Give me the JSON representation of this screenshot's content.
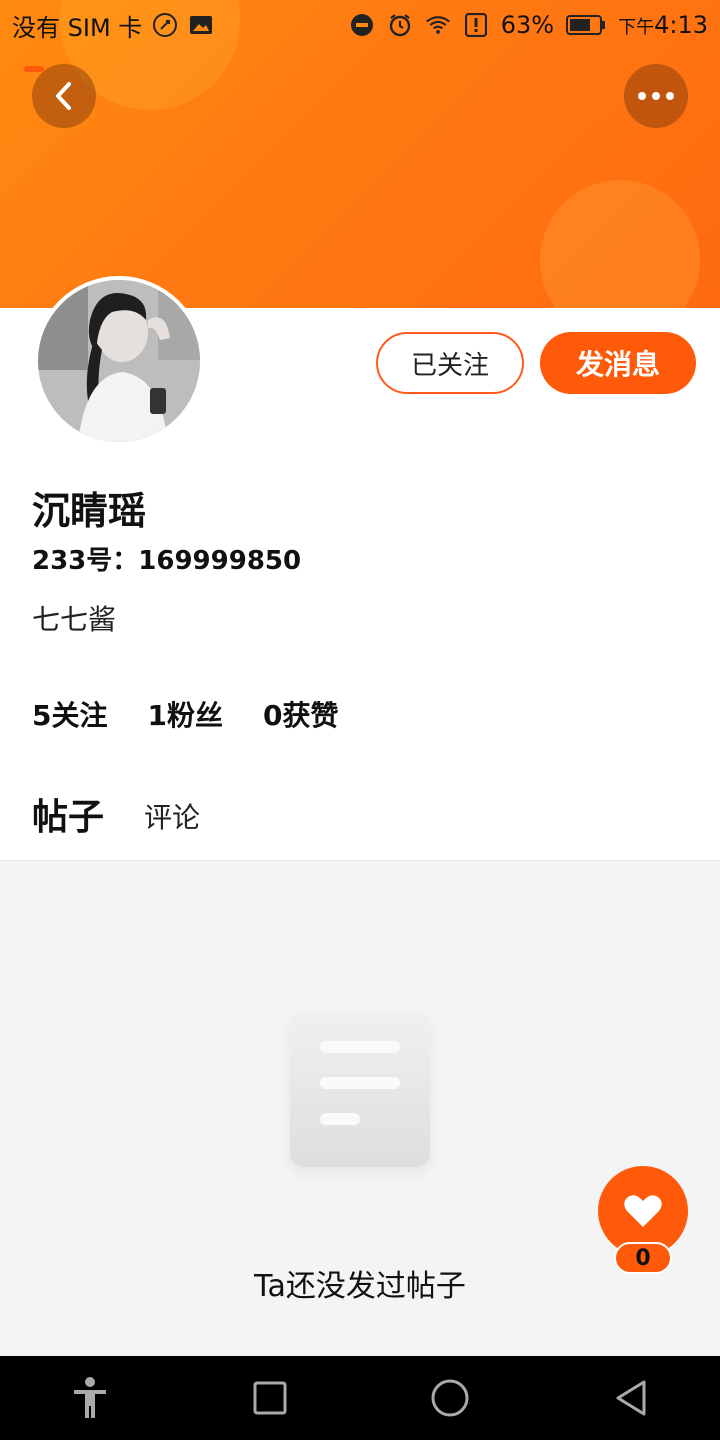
{
  "status_bar": {
    "carrier": "没有 SIM 卡",
    "battery": "63%",
    "time_prefix": "下午",
    "time": "4:13"
  },
  "profile": {
    "name": "沉睛瑶",
    "uid": "233号：169999850",
    "signature": "七七酱",
    "follow_button": "已关注",
    "message_button": "发消息"
  },
  "stats": {
    "following": "5关注",
    "followers": "1粉丝",
    "likes": "0获赞"
  },
  "tabs": {
    "posts": "帖子",
    "comments": "评论"
  },
  "empty_state": {
    "text": "Ta还没发过帖子"
  },
  "like_fab": {
    "count": "0"
  },
  "colors": {
    "accent": "#ff5a0a",
    "banner": "#ff7a12"
  }
}
